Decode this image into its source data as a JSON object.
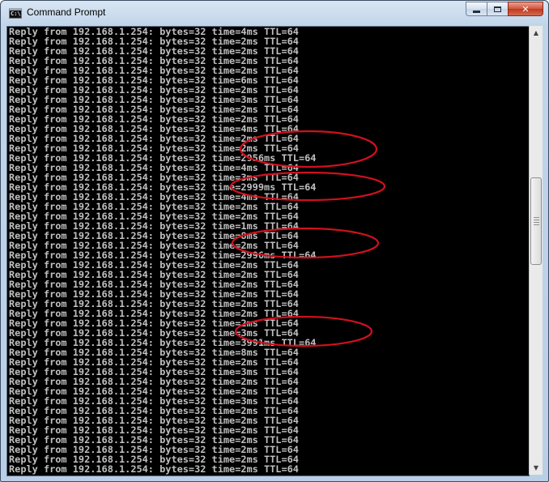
{
  "window": {
    "title": "Command Prompt",
    "icon": "cmd-icon",
    "controls": {
      "minimize": "─",
      "maximize": "□",
      "close": "✕"
    }
  },
  "console": {
    "lines": [
      "Reply from 192.168.1.254: bytes=32 time=4ms TTL=64",
      "Reply from 192.168.1.254: bytes=32 time=2ms TTL=64",
      "Reply from 192.168.1.254: bytes=32 time=2ms TTL=64",
      "Reply from 192.168.1.254: bytes=32 time=2ms TTL=64",
      "Reply from 192.168.1.254: bytes=32 time=2ms TTL=64",
      "Reply from 192.168.1.254: bytes=32 time=6ms TTL=64",
      "Reply from 192.168.1.254: bytes=32 time=2ms TTL=64",
      "Reply from 192.168.1.254: bytes=32 time=3ms TTL=64",
      "Reply from 192.168.1.254: bytes=32 time=2ms TTL=64",
      "Reply from 192.168.1.254: bytes=32 time=2ms TTL=64",
      "Reply from 192.168.1.254: bytes=32 time=4ms TTL=64",
      "Reply from 192.168.1.254: bytes=32 time=2ms TTL=64",
      "Reply from 192.168.1.254: bytes=32 time=2ms TTL=64",
      "Reply from 192.168.1.254: bytes=32 time=2956ms TTL=64",
      "Reply from 192.168.1.254: bytes=32 time=4ms TTL=64",
      "Reply from 192.168.1.254: bytes=32 time=3ms TTL=64",
      "Reply from 192.168.1.254: bytes=32 time=2999ms TTL=64",
      "Reply from 192.168.1.254: bytes=32 time=4ms TTL=64",
      "Reply from 192.168.1.254: bytes=32 time=2ms TTL=64",
      "Reply from 192.168.1.254: bytes=32 time=2ms TTL=64",
      "Reply from 192.168.1.254: bytes=32 time=1ms TTL=64",
      "Reply from 192.168.1.254: bytes=32 time=8ms TTL=64",
      "Reply from 192.168.1.254: bytes=32 time=2ms TTL=64",
      "Reply from 192.168.1.254: bytes=32 time=2996ms TTL=64",
      "Reply from 192.168.1.254: bytes=32 time=2ms TTL=64",
      "Reply from 192.168.1.254: bytes=32 time=2ms TTL=64",
      "Reply from 192.168.1.254: bytes=32 time=2ms TTL=64",
      "Reply from 192.168.1.254: bytes=32 time=2ms TTL=64",
      "Reply from 192.168.1.254: bytes=32 time=2ms TTL=64",
      "Reply from 192.168.1.254: bytes=32 time=2ms TTL=64",
      "Reply from 192.168.1.254: bytes=32 time=2ms TTL=64",
      "Reply from 192.168.1.254: bytes=32 time=3ms TTL=64",
      "Reply from 192.168.1.254: bytes=32 time=3991ms TTL=64",
      "Reply from 192.168.1.254: bytes=32 time=8ms TTL=64",
      "Reply from 192.168.1.254: bytes=32 time=2ms TTL=64",
      "Reply from 192.168.1.254: bytes=32 time=3ms TTL=64",
      "Reply from 192.168.1.254: bytes=32 time=2ms TTL=64",
      "Reply from 192.168.1.254: bytes=32 time=2ms TTL=64",
      "Reply from 192.168.1.254: bytes=32 time=3ms TTL=64",
      "Reply from 192.168.1.254: bytes=32 time=2ms TTL=64",
      "Reply from 192.168.1.254: bytes=32 time=2ms TTL=64",
      "Reply from 192.168.1.254: bytes=32 time=2ms TTL=64",
      "Reply from 192.168.1.254: bytes=32 time=2ms TTL=64",
      "Reply from 192.168.1.254: bytes=32 time=2ms TTL=64",
      "Reply from 192.168.1.254: bytes=32 time=2ms TTL=64",
      "Reply from 192.168.1.254: bytes=32 time=2ms TTL=64"
    ],
    "colors": {
      "background": "#000000",
      "text": "#c0c0c0"
    }
  },
  "annotations": {
    "color": "#d0101e",
    "highlighted_values": [
      "time=2ms TTL=64",
      "time=2956ms TTL=64",
      "time=2999ms TTL=64",
      "time=2996ms TTL=64",
      "time=3991ms TTL=64"
    ]
  }
}
